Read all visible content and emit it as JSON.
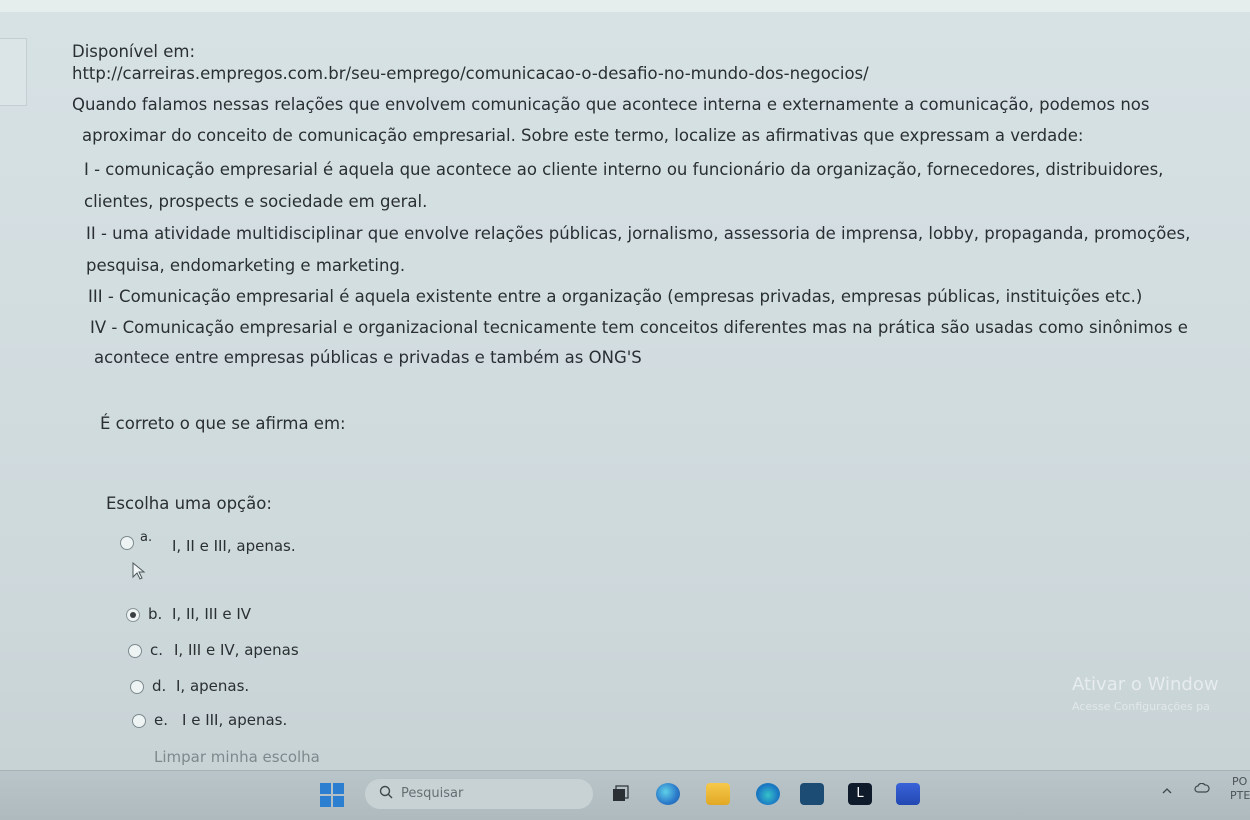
{
  "header": {
    "available_label": "Disponível em:",
    "url": "http://carreiras.empregos.com.br/seu-emprego/comunicacao-o-desafio-no-mundo-dos-negocios/"
  },
  "question": {
    "intro_line1": "Quando falamos nessas relações que envolvem comunicação que acontece interna e externamente a comunicação, podemos nos",
    "intro_line2": "aproximar do conceito de comunicação empresarial. Sobre este termo, localize as afirmativas que expressam a verdade:",
    "stmt1_line1": "I - comunicação empresarial é aquela que acontece ao cliente interno ou funcionário da organização, fornecedores, distribuidores,",
    "stmt1_line2": "clientes, prospects e sociedade em geral.",
    "stmt2_line1": "II - uma atividade multidisciplinar que envolve relações públicas, jornalismo, assessoria de imprensa, lobby, propaganda, promoções,",
    "stmt2_line2": "pesquisa, endomarketing e marketing.",
    "stmt3_line1": "III - Comunicação empresarial é aquela existente entre a organização (empresas privadas, empresas públicas, instituições etc.)",
    "stmt4_line1": "IV - Comunicação empresarial  e organizacional tecnicamente tem conceitos diferentes mas na prática são usadas como sinônimos e",
    "stmt4_line2": "acontece entre empresas públicas e privadas e também as ONG'S",
    "prompt": "É correto o que se afirma em:"
  },
  "choices": {
    "label": "Escolha uma opção:",
    "options": [
      {
        "letter": "a.",
        "text": "I, II e III, apenas.",
        "selected": false
      },
      {
        "letter": "b.",
        "text": "I, II, III e  IV",
        "selected": true
      },
      {
        "letter": "c.",
        "text": "I, III e IV, apenas",
        "selected": false
      },
      {
        "letter": "d.",
        "text": "I, apenas.",
        "selected": false
      },
      {
        "letter": "e.",
        "text": "I e III, apenas.",
        "selected": false
      }
    ],
    "clear_label": "Limpar minha escolha"
  },
  "watermark": {
    "title": "Ativar o Window",
    "subtitle": "Acesse Configurações pa"
  },
  "taskbar": {
    "search_placeholder": "Pesquisar",
    "tray_lang": "PO",
    "tray_region": "PTE"
  },
  "colors": {
    "page_background": "#d2dde0",
    "windows_blue": "#2c7fd0"
  }
}
